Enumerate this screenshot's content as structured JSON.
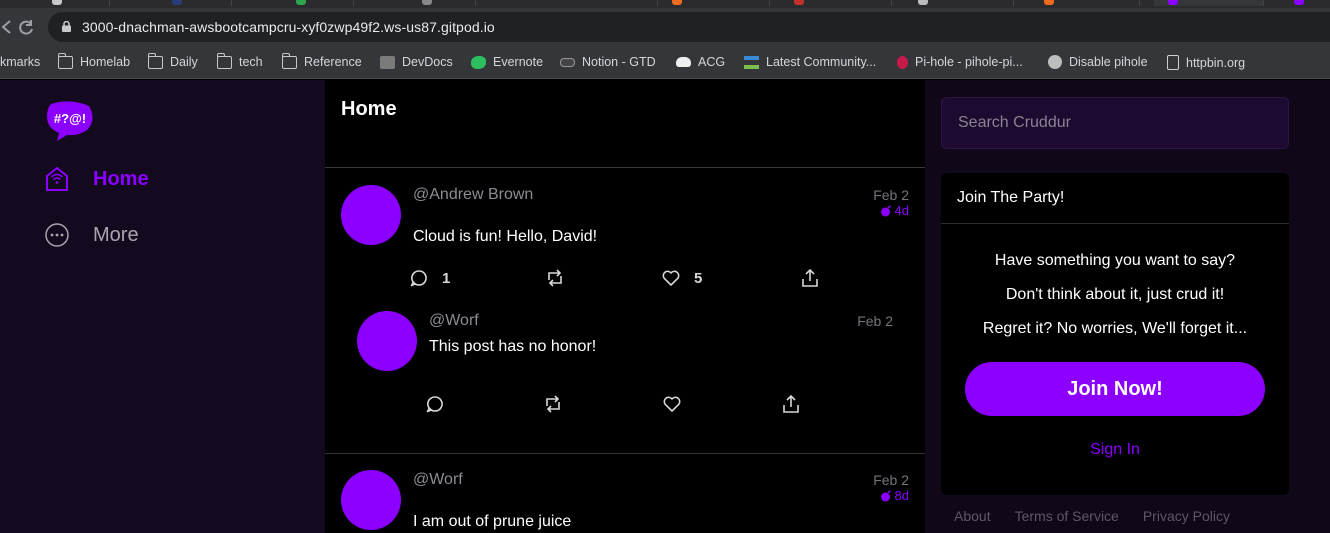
{
  "browser": {
    "url": "3000-dnachman-awsbootcampcru-xyf0zwp49f2.ws-us87.gitpod.io",
    "bookmarks": [
      {
        "label": "kmarks",
        "icon": "bookmarks-icon"
      },
      {
        "label": "Homelab",
        "icon": "folder-icon"
      },
      {
        "label": "Daily",
        "icon": "folder-icon"
      },
      {
        "label": "tech",
        "icon": "folder-icon"
      },
      {
        "label": "Reference",
        "icon": "folder-icon"
      },
      {
        "label": "DevDocs",
        "icon": "devdocs-icon"
      },
      {
        "label": "Evernote",
        "icon": "evernote-icon"
      },
      {
        "label": "Notion - GTD",
        "icon": "notion-icon"
      },
      {
        "label": "ACG",
        "icon": "cloud-icon"
      },
      {
        "label": "Latest Community...",
        "icon": "community-icon"
      },
      {
        "label": "Pi-hole - pihole-pi...",
        "icon": "raspberry-icon"
      },
      {
        "label": "Disable pihole",
        "icon": "globe-icon"
      },
      {
        "label": "httpbin.org",
        "icon": "httpbin-icon"
      }
    ]
  },
  "sidebar": {
    "logo_text": "#?@!",
    "items": [
      {
        "label": "Home",
        "icon": "home-icon",
        "active": true
      },
      {
        "label": "More",
        "icon": "more-icon",
        "active": false
      }
    ]
  },
  "feed": {
    "title": "Home",
    "activities": [
      {
        "handle": "@Andrew Brown",
        "date": "Feb 2",
        "expires": "4d",
        "message": "Cloud is fun! Hello, David!",
        "replies_count": "1",
        "likes_count": "5",
        "replies": [
          {
            "handle": "@Worf",
            "date": "Feb 2",
            "message": "This post has no honor!"
          }
        ]
      },
      {
        "handle": "@Worf",
        "date": "Feb 2",
        "expires": "8d",
        "message": "I am out of prune juice"
      }
    ]
  },
  "search": {
    "placeholder": "Search Cruddur"
  },
  "join": {
    "title": "Join The Party!",
    "lines": [
      "Have something you want to say?",
      "Don't think about it, just crud it!",
      "Regret it? No worries, We'll forget it..."
    ],
    "button_label": "Join Now!",
    "signin_label": "Sign In"
  },
  "footer": {
    "links": [
      "About",
      "Terms of Service",
      "Privacy Policy"
    ]
  },
  "colors": {
    "accent": "#8b00ff",
    "background": "#000000",
    "sidebar": "#140a1f"
  }
}
